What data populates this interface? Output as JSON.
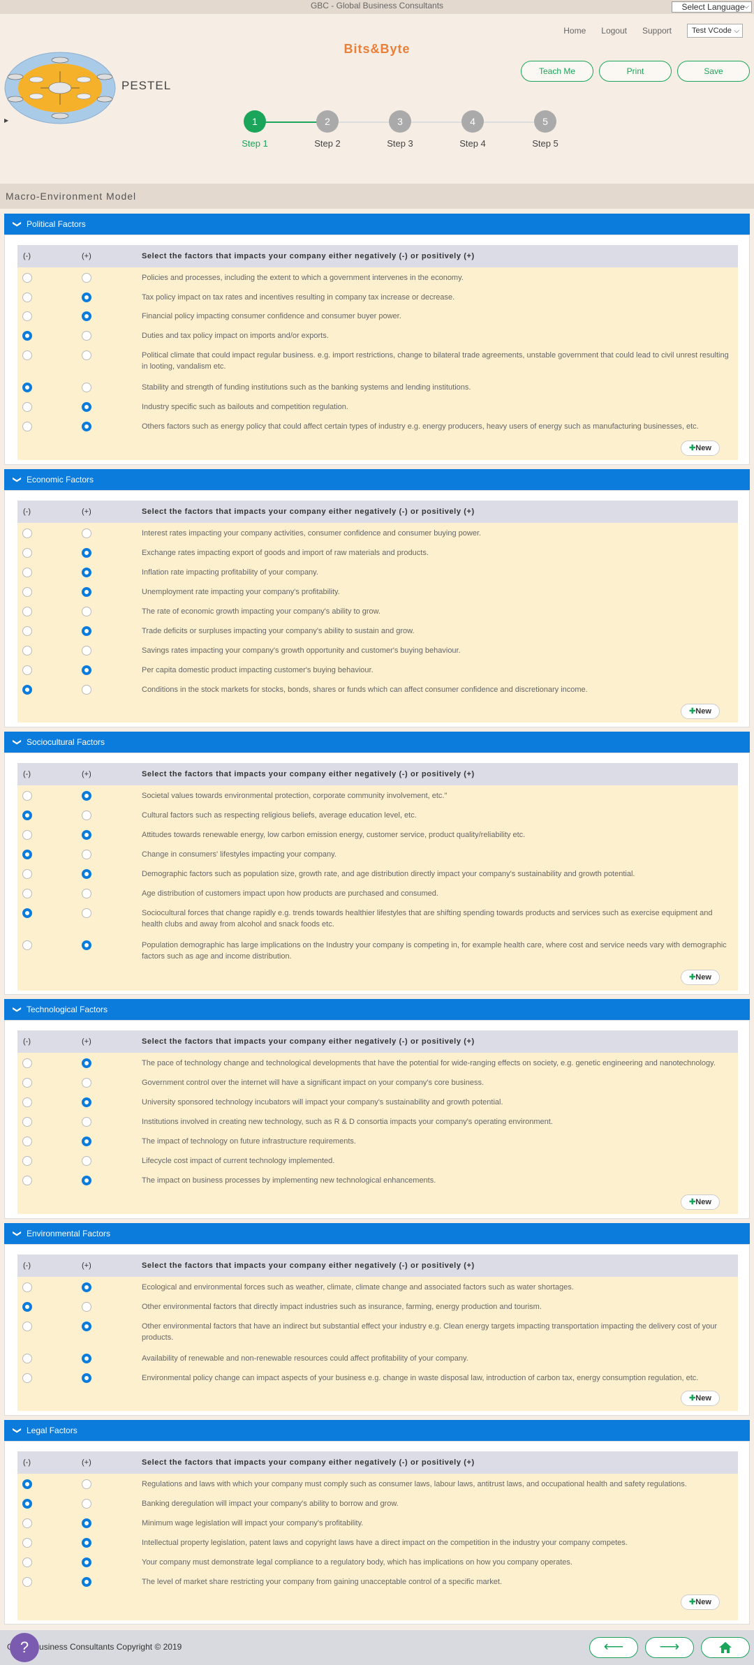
{
  "topbar": {
    "title": "GBC - Global Business Consultants",
    "language_select": "Select Language"
  },
  "nav": {
    "home": "Home",
    "logout": "Logout",
    "support": "Support",
    "user": "Test VCode"
  },
  "brand": "Bits&Byte",
  "page_name": "PESTEL",
  "actions": {
    "teach": "Teach Me",
    "print": "Print",
    "save": "Save"
  },
  "steps": [
    {
      "number": "1",
      "label": "Step 1",
      "active": true
    },
    {
      "number": "2",
      "label": "Step 2",
      "active": false
    },
    {
      "number": "3",
      "label": "Step 3",
      "active": false
    },
    {
      "number": "4",
      "label": "Step 4",
      "active": false
    },
    {
      "number": "5",
      "label": "Step 5",
      "active": false
    }
  ],
  "model_title": "Macro-Environment Model",
  "table_header": {
    "neg": "(-)",
    "pos": "(+)",
    "title": "Select the factors that impacts your company either negatively (-) or positively (+)"
  },
  "new_label": "New",
  "sections": [
    {
      "title": "Political Factors",
      "rows": [
        {
          "text": "Policies and processes, including the extent to which a government intervenes in the economy.",
          "value": "none"
        },
        {
          "text": "Tax policy impact on tax rates and incentives resulting in company tax increase or decrease.",
          "value": "pos"
        },
        {
          "text": "Financial policy impacting consumer confidence and consumer buyer power.",
          "value": "pos"
        },
        {
          "text": "Duties and tax policy impact on imports and/or exports.",
          "value": "neg"
        },
        {
          "text": "Political climate that could impact regular business. e.g. import restrictions, change to bilateral trade agreements, unstable government that could lead to civil unrest resulting in looting, vandalism etc.",
          "value": "none"
        },
        {
          "text": "Stability and strength of funding institutions such as the banking systems and lending institutions.",
          "value": "neg"
        },
        {
          "text": "Industry specific such as bailouts and competition regulation.",
          "value": "pos"
        },
        {
          "text": "Others factors such as energy policy that could affect certain types of industry e.g. energy producers, heavy users of energy such as manufacturing businesses, etc.",
          "value": "pos"
        }
      ]
    },
    {
      "title": "Economic Factors",
      "rows": [
        {
          "text": "Interest rates impacting your company activities, consumer confidence and consumer buying power.",
          "value": "none"
        },
        {
          "text": "Exchange rates impacting export of goods and import of raw materials and products.",
          "value": "pos"
        },
        {
          "text": "Inflation rate impacting profitability of your company.",
          "value": "pos"
        },
        {
          "text": "Unemployment rate impacting your company's profitability.",
          "value": "pos"
        },
        {
          "text": "The rate of economic growth impacting your company's ability to grow.",
          "value": "none"
        },
        {
          "text": "Trade deficits or surpluses impacting your company's ability to sustain and grow.",
          "value": "pos"
        },
        {
          "text": "Savings rates impacting your company's growth opportunity and customer's buying behaviour.",
          "value": "none"
        },
        {
          "text": "Per capita domestic product impacting customer's buying behaviour.",
          "value": "pos"
        },
        {
          "text": "Conditions in the stock markets for stocks, bonds, shares or funds which can affect consumer confidence and discretionary income.",
          "value": "neg"
        }
      ]
    },
    {
      "title": "Sociocultural Factors",
      "rows": [
        {
          "text": "Societal values towards environmental protection, corporate community involvement, etc.\"",
          "value": "pos"
        },
        {
          "text": "Cultural factors such as respecting religious beliefs, average education level, etc.",
          "value": "neg"
        },
        {
          "text": "Attitudes towards renewable energy, low carbon emission energy, customer service, product quality/reliability etc.",
          "value": "pos"
        },
        {
          "text": "Change in consumers' lifestyles impacting your company.",
          "value": "neg"
        },
        {
          "text": "Demographic factors such as population size, growth rate, and age distribution directly impact your company's sustainability and growth potential.",
          "value": "pos"
        },
        {
          "text": "Age distribution of customers impact upon how products are purchased and consumed.",
          "value": "none"
        },
        {
          "text": "Sociocultural forces that change rapidly e.g. trends towards healthier lifestyles that are shifting spending towards products and services such as exercise equipment and health clubs and away from alcohol and snack foods etc.",
          "value": "neg"
        },
        {
          "text": "Population demographic has large implications on the Industry your company is competing in, for example health care, where cost and service needs vary with demographic factors such as age and income distribution.",
          "value": "pos"
        }
      ]
    },
    {
      "title": "Technological Factors",
      "rows": [
        {
          "text": "The pace of technology change and technological developments that have the potential for wide-ranging effects on society, e.g. genetic engineering and nanotechnology.",
          "value": "pos"
        },
        {
          "text": "Government control over the internet will have a significant impact on your company's core business.",
          "value": "none"
        },
        {
          "text": "University sponsored technology incubators will impact your company's sustainability and growth potential.",
          "value": "pos"
        },
        {
          "text": "Institutions involved in creating new technology, such as R & D consortia impacts your company's operating environment.",
          "value": "none"
        },
        {
          "text": "The impact of technology on future infrastructure requirements.",
          "value": "pos"
        },
        {
          "text": "Lifecycle cost impact of current technology implemented.",
          "value": "none"
        },
        {
          "text": "The impact on business processes by implementing new technological enhancements.",
          "value": "pos"
        }
      ]
    },
    {
      "title": "Environmental Factors",
      "rows": [
        {
          "text": "Ecological and environmental forces such as weather, climate, climate change and associated factors such as water shortages.",
          "value": "pos"
        },
        {
          "text": "Other environmental factors that directly impact industries such as insurance, farming, energy production and tourism.",
          "value": "neg"
        },
        {
          "text": "Other environmental factors that have an indirect but substantial effect your industry e.g. Clean energy targets impacting transportation impacting the delivery cost of your products.",
          "value": "pos"
        },
        {
          "text": "Availability of renewable and non-renewable resources could affect profitability of your company.",
          "value": "pos"
        },
        {
          "text": "Environmental policy change can impact aspects of your business e.g. change in waste disposal law, introduction of carbon tax, energy consumption regulation, etc.",
          "value": "pos"
        }
      ]
    },
    {
      "title": "Legal Factors",
      "rows": [
        {
          "text": "Regulations and laws with which your company must comply such as consumer laws, labour laws, antitrust laws, and occupational health and safety regulations.",
          "value": "neg"
        },
        {
          "text": "Banking deregulation will impact your company's ability to borrow and grow.",
          "value": "neg"
        },
        {
          "text": "Minimum wage legislation will impact your company's profitability.",
          "value": "pos"
        },
        {
          "text": "Intellectual property legislation, patent laws and copyright laws have a direct impact on the competition in the industry your company competes.",
          "value": "pos"
        },
        {
          "text": "Your company must demonstrate legal compliance to a regulatory body, which has implications on how you company operates.",
          "value": "pos"
        },
        {
          "text": "The level of market share restricting your company from gaining unacceptable control of a specific market.",
          "value": "pos"
        }
      ]
    }
  ],
  "footer": {
    "copyright": "Global Business Consultants Copyright © 2019",
    "help": "?"
  }
}
